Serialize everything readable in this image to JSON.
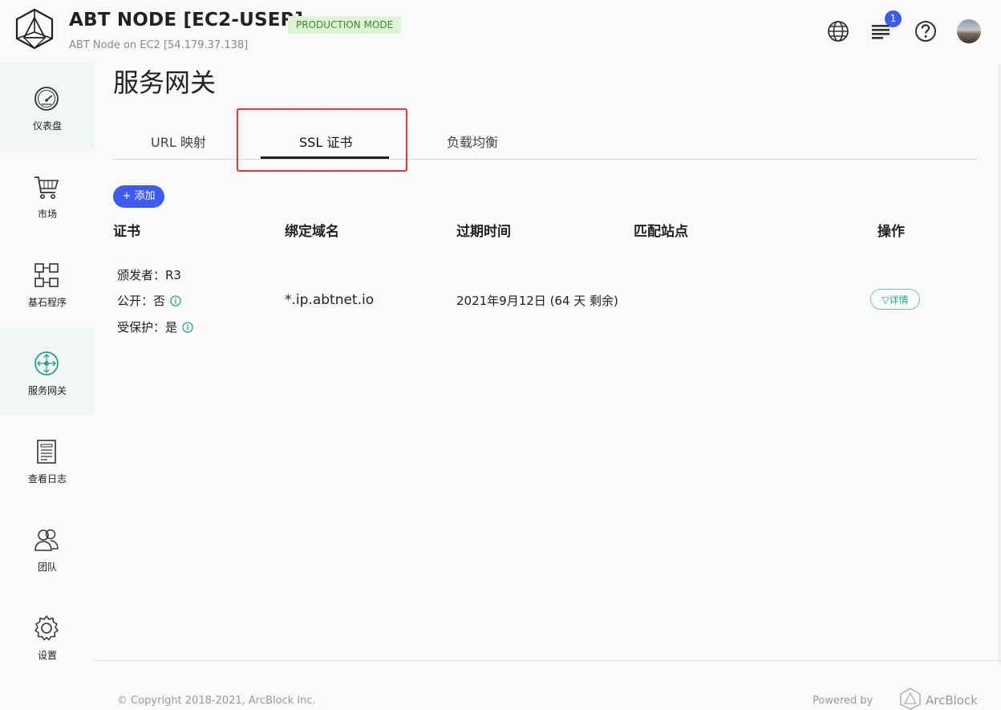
{
  "header": {
    "title": "ABT NODE [EC2-USER]",
    "mode_badge": "PRODUCTION MODE",
    "subtitle": "ABT Node on EC2 [54.179.37.138]",
    "notification_count": "1",
    "accent_color": "#3d5af1"
  },
  "sidebar": {
    "items": [
      {
        "label": "仪表盘",
        "icon": "dashboard-gauge-icon"
      },
      {
        "label": "市场",
        "icon": "shopping-cart-icon"
      },
      {
        "label": "基石程序",
        "icon": "blocklets-grid-icon"
      },
      {
        "label": "服务网关",
        "icon": "gateway-arrows-icon",
        "active": true
      },
      {
        "label": "查看日志",
        "icon": "log-document-icon"
      },
      {
        "label": "团队",
        "icon": "team-people-icon"
      },
      {
        "label": "设置",
        "icon": "gear-icon"
      }
    ]
  },
  "main": {
    "page_title": "服务网关",
    "tabs": [
      {
        "label": "URL 映射"
      },
      {
        "label": "SSL 证书",
        "active": true
      },
      {
        "label": "负载均衡"
      }
    ],
    "add_button": "+ 添加",
    "table": {
      "headers": [
        "证书",
        "绑定域名",
        "过期时间",
        "匹配站点",
        "操作"
      ],
      "rows": [
        {
          "issuer": "颁发者：R3",
          "public": "公开：否",
          "protected": "受保护：是",
          "domain": "*.ip.abtnet.io",
          "expires": "2021年9月12日 (64 天 剩余)",
          "sites": "",
          "action": "▽详情"
        }
      ]
    }
  },
  "footer": {
    "copyright": "© Copyright 2018-2021, ArcBlock Inc.",
    "powered_by": "Powered by",
    "brand": "ArcBlock"
  }
}
